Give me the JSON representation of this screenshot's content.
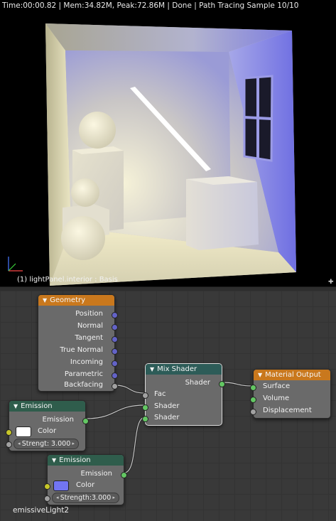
{
  "status_bar": {
    "text": "Time:00:00.82 | Mem:34.82M, Peak:72.86M | Done | Path Tracing Sample 10/10"
  },
  "viewport": {
    "object_label": "(1) lightPanel.interior : Basis"
  },
  "nodes": {
    "geometry": {
      "title": "Geometry",
      "outputs": [
        "Position",
        "Normal",
        "Tangent",
        "True Normal",
        "Incoming",
        "Parametric",
        "Backfacing"
      ]
    },
    "mix_shader": {
      "title": "Mix Shader",
      "output": "Shader",
      "inputs": [
        "Fac",
        "Shader",
        "Shader"
      ]
    },
    "material_output": {
      "title": "Material Output",
      "inputs": [
        "Surface",
        "Volume",
        "Displacement"
      ]
    },
    "emission_1": {
      "title": "Emission",
      "output": "Emission",
      "color_label": "Color",
      "color_value": "#ffffff",
      "strength_text": "Strengt: 3.000"
    },
    "emission_2": {
      "title": "Emission",
      "output": "Emission",
      "color_label": "Color",
      "color_value": "#7275f2",
      "strength_text": "Strength:3.000"
    }
  },
  "node_editor": {
    "frame_label": "emissiveLight2"
  },
  "colors": {
    "node_header_input": "#c9781d",
    "node_header_shader": "#2d5c58",
    "node_header_output": "#c9781d",
    "socket_vector": "#6363c7",
    "socket_shader": "#63c763",
    "socket_float": "#a1a1a1",
    "socket_color": "#c7c729"
  }
}
